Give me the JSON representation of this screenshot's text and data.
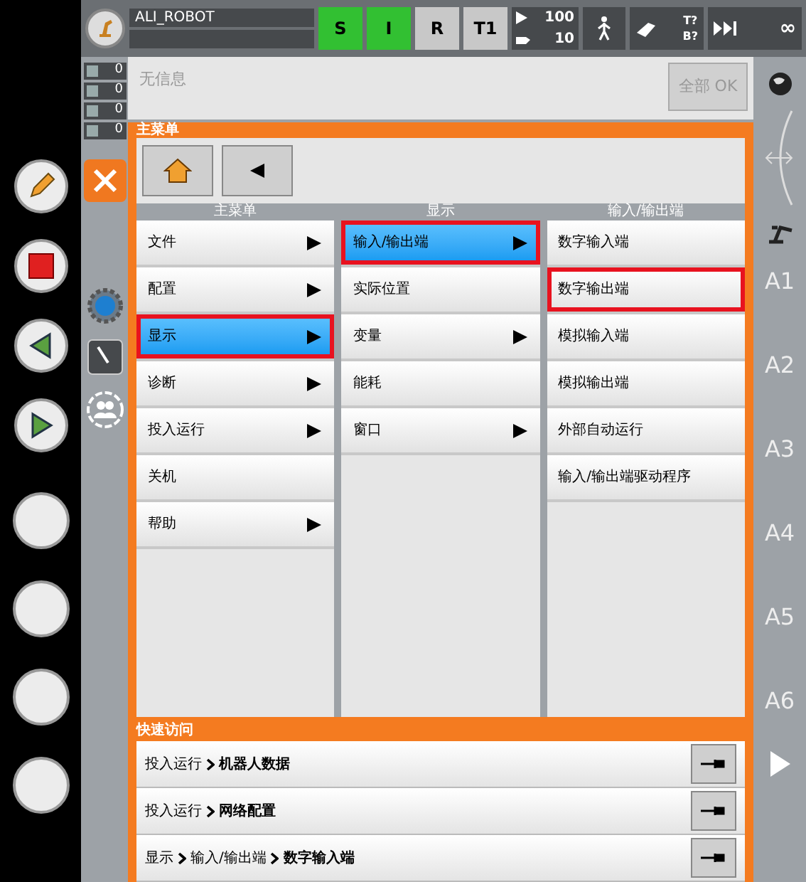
{
  "header": {
    "robot_name": "ALI_ROBOT",
    "status_buttons": [
      {
        "label": "S",
        "on": true
      },
      {
        "label": "I",
        "on": true
      },
      {
        "label": "R",
        "on": false
      },
      {
        "label": "T1",
        "on": false
      }
    ],
    "override": {
      "program": "100",
      "jog": "10"
    },
    "tool_base": {
      "tool": "T?",
      "base": "B?"
    },
    "run_mode": "∞"
  },
  "messages": {
    "counters": [
      "0",
      "0",
      "0",
      "0"
    ],
    "text": "无信息",
    "ok_button": {
      "label": "全部 OK",
      "disabled": true
    }
  },
  "main_menu": {
    "title": "主菜单",
    "columns": [
      {
        "header": "主菜单",
        "items": [
          {
            "label": "文件",
            "submenu": true,
            "selected": false,
            "highlighted": false
          },
          {
            "label": "配置",
            "submenu": true,
            "selected": false,
            "highlighted": false
          },
          {
            "label": "显示",
            "submenu": true,
            "selected": true,
            "highlighted": true
          },
          {
            "label": "诊断",
            "submenu": true,
            "selected": false,
            "highlighted": false
          },
          {
            "label": "投入运行",
            "submenu": true,
            "selected": false,
            "highlighted": false
          },
          {
            "label": "关机",
            "submenu": false,
            "selected": false,
            "highlighted": false
          },
          {
            "label": "帮助",
            "submenu": true,
            "selected": false,
            "highlighted": false
          }
        ]
      },
      {
        "header": "显示",
        "items": [
          {
            "label": "输入/输出端",
            "submenu": true,
            "selected": true,
            "highlighted": true
          },
          {
            "label": "实际位置",
            "submenu": false,
            "selected": false,
            "highlighted": false
          },
          {
            "label": "变量",
            "submenu": true,
            "selected": false,
            "highlighted": false
          },
          {
            "label": "能耗",
            "submenu": false,
            "selected": false,
            "highlighted": false
          },
          {
            "label": "窗口",
            "submenu": true,
            "selected": false,
            "highlighted": false
          }
        ]
      },
      {
        "header": "输入/输出端",
        "items": [
          {
            "label": "数字输入端",
            "submenu": false,
            "selected": false,
            "highlighted": false
          },
          {
            "label": "数字输出端",
            "submenu": false,
            "selected": false,
            "highlighted": true
          },
          {
            "label": "模拟输入端",
            "submenu": false,
            "selected": false,
            "highlighted": false
          },
          {
            "label": "模拟输出端",
            "submenu": false,
            "selected": false,
            "highlighted": false
          },
          {
            "label": "外部自动运行",
            "submenu": false,
            "selected": false,
            "highlighted": false
          },
          {
            "label": "输入/输出端驱动程序",
            "submenu": false,
            "selected": false,
            "highlighted": false
          }
        ]
      }
    ]
  },
  "quick_access": {
    "title": "快速访问",
    "rows": [
      {
        "path": [
          "投入运行"
        ],
        "target": "机器人数据"
      },
      {
        "path": [
          "投入运行"
        ],
        "target": "网络配置"
      },
      {
        "path": [
          "显示",
          "输入/输出端"
        ],
        "target": "数字输入端"
      }
    ]
  },
  "axes": [
    "A1",
    "A2",
    "A3",
    "A4",
    "A5",
    "A6"
  ]
}
